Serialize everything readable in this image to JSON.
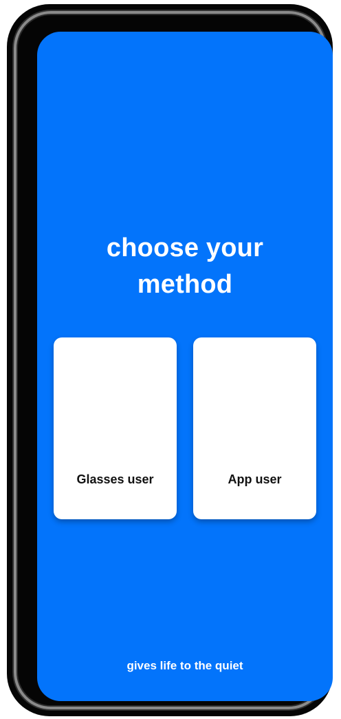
{
  "screen": {
    "background_color": "#0374fb",
    "title_lines": [
      "choose your",
      "method"
    ],
    "options": [
      {
        "label": "Glasses user"
      },
      {
        "label": "App user"
      }
    ],
    "tagline": "gives life to the quiet"
  },
  "device": {
    "frame_color": "#050505",
    "bezel_color": "#8a8a8a"
  }
}
